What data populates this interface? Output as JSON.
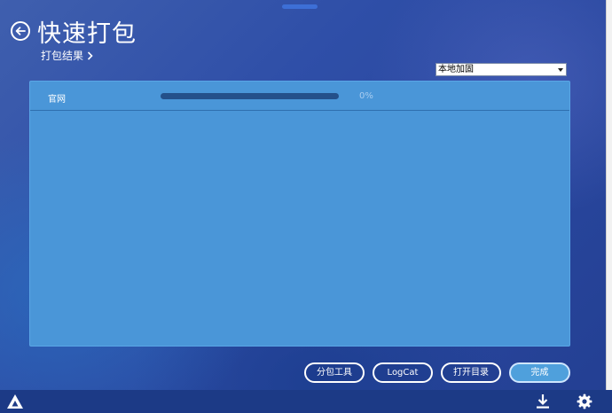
{
  "header": {
    "title": "快速打包",
    "breadcrumb": "打包结果"
  },
  "mode_select": {
    "selected": "本地加固"
  },
  "results": {
    "rows": [
      {
        "label": "官网",
        "progress": 0,
        "percent_text": "0%"
      }
    ]
  },
  "actions": {
    "split_tool": "分包工具",
    "logcat": "LogCat",
    "open_dir": "打开目录",
    "done": "完成"
  },
  "icons": {
    "back": "back-arrow-icon",
    "chevron": "chevron-right-icon",
    "dropdown": "chevron-down-icon",
    "logo": "app-logo-icon",
    "download": "download-icon",
    "settings": "gear-icon"
  },
  "colors": {
    "panel": "#4a96d8",
    "progress_track": "#24508a",
    "primary_button": "#4fa0dc"
  }
}
